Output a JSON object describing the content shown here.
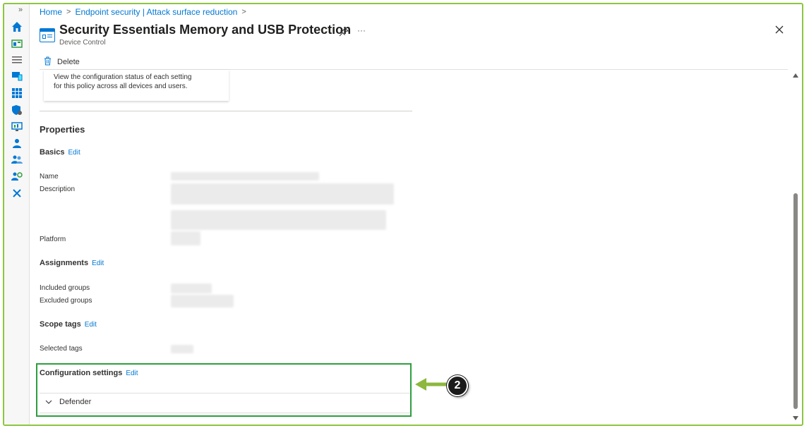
{
  "breadcrumb": {
    "home": "Home",
    "endpoint": "Endpoint security | Attack surface reduction"
  },
  "header": {
    "title": "Security Essentials Memory and USB Protection",
    "subtitle": "Device Control",
    "more": "···"
  },
  "toolbar": {
    "delete_label": "Delete"
  },
  "status_card": {
    "line1": "View the configuration status of each setting",
    "line2": "for this policy across all devices and users."
  },
  "properties": {
    "heading": "Properties",
    "edit_label": "Edit",
    "basics": {
      "heading": "Basics",
      "name_label": "Name",
      "description_label": "Description",
      "platform_label": "Platform"
    },
    "assignments": {
      "heading": "Assignments",
      "included_label": "Included groups",
      "excluded_label": "Excluded groups"
    },
    "scope_tags": {
      "heading": "Scope tags",
      "selected_label": "Selected tags"
    },
    "configuration": {
      "heading": "Configuration settings",
      "defender_label": "Defender"
    }
  },
  "annotation": {
    "step": "2"
  },
  "colors": {
    "accent": "#0078d4",
    "frame": "#8cc63f",
    "highlight_box": "#2e9e3f",
    "arrow": "#8cb83d"
  },
  "icons": [
    "home-icon",
    "dashboard-icon",
    "all-services-icon",
    "devices-icon",
    "apps-icon",
    "endpoint-security-icon",
    "reports-icon",
    "users-icon",
    "groups-icon",
    "tenant-admin-icon",
    "troubleshooting-icon",
    "delete-icon",
    "pin-icon",
    "close-icon",
    "chevron-down-icon"
  ]
}
